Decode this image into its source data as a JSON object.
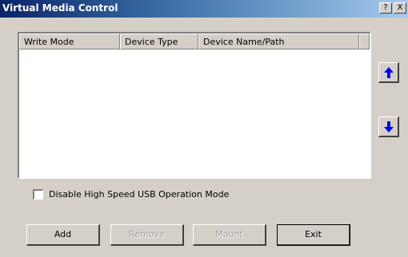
{
  "window": {
    "title": "Virtual Media Control",
    "help_label": "?",
    "close_label": "X"
  },
  "device_list": {
    "columns": [
      "Write Mode",
      "Device Type",
      "Device Name/Path"
    ],
    "rows": []
  },
  "reorder": {
    "up_icon": "arrow-up-icon",
    "down_icon": "arrow-down-icon",
    "arrow_color": "#0000ff"
  },
  "options": {
    "disable_high_speed_usb_label": "Disable High Speed USB Operation Mode",
    "disable_high_speed_usb_checked": false
  },
  "buttons": {
    "add": "Add",
    "remove": "Remove",
    "mount": "Mount",
    "exit": "Exit"
  }
}
